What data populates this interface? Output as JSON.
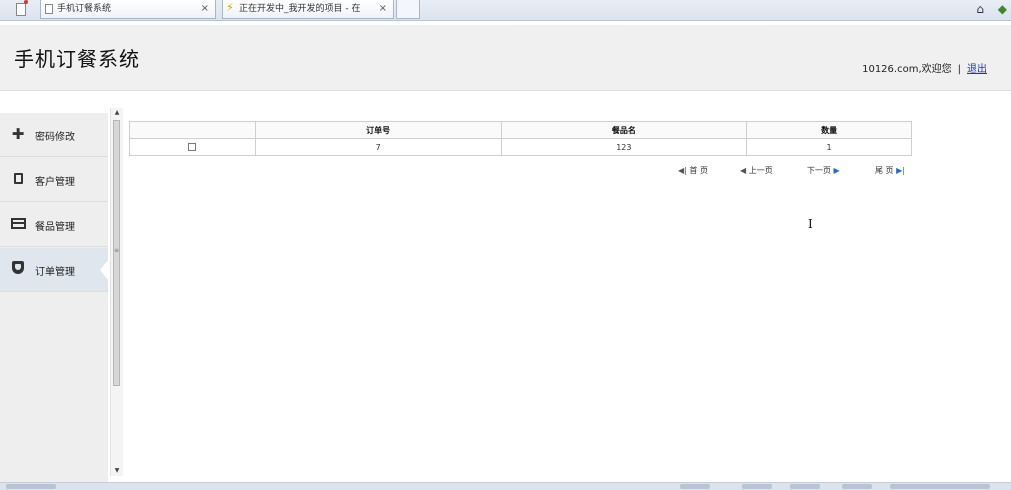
{
  "browser": {
    "tabs": [
      {
        "label": "手机订餐系统",
        "close": "×"
      },
      {
        "label": "正在开发中_我开发的项目 - 在",
        "close": "×"
      }
    ]
  },
  "header": {
    "title": "手机订餐系统",
    "user": "10126.com,",
    "welcome": "欢迎您",
    "separator": "|",
    "logout": "退出"
  },
  "sidebar": {
    "items": [
      {
        "label": "密码修改",
        "icon": "plus-icon"
      },
      {
        "label": "客户管理",
        "icon": "tablet-icon"
      },
      {
        "label": "餐品管理",
        "icon": "card-icon"
      },
      {
        "label": "订单管理",
        "icon": "shield-icon",
        "active": true
      }
    ]
  },
  "table": {
    "columns": [
      "",
      "订单号",
      "餐品名",
      "数量"
    ],
    "rows": [
      {
        "checked": false,
        "order_no": "7",
        "dish": "123",
        "quantity": "1"
      }
    ]
  },
  "pager": {
    "first": "首 页",
    "prev": "上一页",
    "next": "下一页",
    "last": "尾 页"
  }
}
